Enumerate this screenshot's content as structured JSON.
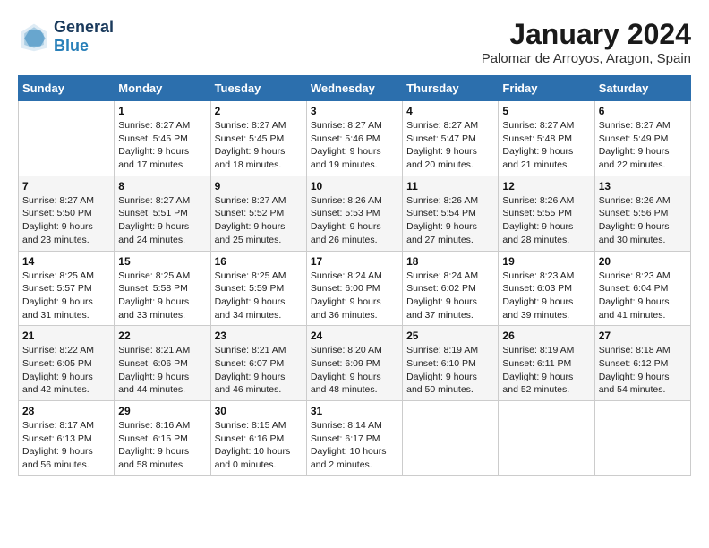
{
  "header": {
    "logo_line1": "General",
    "logo_line2": "Blue",
    "month_title": "January 2024",
    "location": "Palomar de Arroyos, Aragon, Spain"
  },
  "days_of_week": [
    "Sunday",
    "Monday",
    "Tuesday",
    "Wednesday",
    "Thursday",
    "Friday",
    "Saturday"
  ],
  "weeks": [
    [
      {
        "day": "",
        "sunrise": "",
        "sunset": "",
        "daylight": ""
      },
      {
        "day": "1",
        "sunrise": "Sunrise: 8:27 AM",
        "sunset": "Sunset: 5:45 PM",
        "daylight": "Daylight: 9 hours and 17 minutes."
      },
      {
        "day": "2",
        "sunrise": "Sunrise: 8:27 AM",
        "sunset": "Sunset: 5:45 PM",
        "daylight": "Daylight: 9 hours and 18 minutes."
      },
      {
        "day": "3",
        "sunrise": "Sunrise: 8:27 AM",
        "sunset": "Sunset: 5:46 PM",
        "daylight": "Daylight: 9 hours and 19 minutes."
      },
      {
        "day": "4",
        "sunrise": "Sunrise: 8:27 AM",
        "sunset": "Sunset: 5:47 PM",
        "daylight": "Daylight: 9 hours and 20 minutes."
      },
      {
        "day": "5",
        "sunrise": "Sunrise: 8:27 AM",
        "sunset": "Sunset: 5:48 PM",
        "daylight": "Daylight: 9 hours and 21 minutes."
      },
      {
        "day": "6",
        "sunrise": "Sunrise: 8:27 AM",
        "sunset": "Sunset: 5:49 PM",
        "daylight": "Daylight: 9 hours and 22 minutes."
      }
    ],
    [
      {
        "day": "7",
        "sunrise": "Sunrise: 8:27 AM",
        "sunset": "Sunset: 5:50 PM",
        "daylight": "Daylight: 9 hours and 23 minutes."
      },
      {
        "day": "8",
        "sunrise": "Sunrise: 8:27 AM",
        "sunset": "Sunset: 5:51 PM",
        "daylight": "Daylight: 9 hours and 24 minutes."
      },
      {
        "day": "9",
        "sunrise": "Sunrise: 8:27 AM",
        "sunset": "Sunset: 5:52 PM",
        "daylight": "Daylight: 9 hours and 25 minutes."
      },
      {
        "day": "10",
        "sunrise": "Sunrise: 8:26 AM",
        "sunset": "Sunset: 5:53 PM",
        "daylight": "Daylight: 9 hours and 26 minutes."
      },
      {
        "day": "11",
        "sunrise": "Sunrise: 8:26 AM",
        "sunset": "Sunset: 5:54 PM",
        "daylight": "Daylight: 9 hours and 27 minutes."
      },
      {
        "day": "12",
        "sunrise": "Sunrise: 8:26 AM",
        "sunset": "Sunset: 5:55 PM",
        "daylight": "Daylight: 9 hours and 28 minutes."
      },
      {
        "day": "13",
        "sunrise": "Sunrise: 8:26 AM",
        "sunset": "Sunset: 5:56 PM",
        "daylight": "Daylight: 9 hours and 30 minutes."
      }
    ],
    [
      {
        "day": "14",
        "sunrise": "Sunrise: 8:25 AM",
        "sunset": "Sunset: 5:57 PM",
        "daylight": "Daylight: 9 hours and 31 minutes."
      },
      {
        "day": "15",
        "sunrise": "Sunrise: 8:25 AM",
        "sunset": "Sunset: 5:58 PM",
        "daylight": "Daylight: 9 hours and 33 minutes."
      },
      {
        "day": "16",
        "sunrise": "Sunrise: 8:25 AM",
        "sunset": "Sunset: 5:59 PM",
        "daylight": "Daylight: 9 hours and 34 minutes."
      },
      {
        "day": "17",
        "sunrise": "Sunrise: 8:24 AM",
        "sunset": "Sunset: 6:00 PM",
        "daylight": "Daylight: 9 hours and 36 minutes."
      },
      {
        "day": "18",
        "sunrise": "Sunrise: 8:24 AM",
        "sunset": "Sunset: 6:02 PM",
        "daylight": "Daylight: 9 hours and 37 minutes."
      },
      {
        "day": "19",
        "sunrise": "Sunrise: 8:23 AM",
        "sunset": "Sunset: 6:03 PM",
        "daylight": "Daylight: 9 hours and 39 minutes."
      },
      {
        "day": "20",
        "sunrise": "Sunrise: 8:23 AM",
        "sunset": "Sunset: 6:04 PM",
        "daylight": "Daylight: 9 hours and 41 minutes."
      }
    ],
    [
      {
        "day": "21",
        "sunrise": "Sunrise: 8:22 AM",
        "sunset": "Sunset: 6:05 PM",
        "daylight": "Daylight: 9 hours and 42 minutes."
      },
      {
        "day": "22",
        "sunrise": "Sunrise: 8:21 AM",
        "sunset": "Sunset: 6:06 PM",
        "daylight": "Daylight: 9 hours and 44 minutes."
      },
      {
        "day": "23",
        "sunrise": "Sunrise: 8:21 AM",
        "sunset": "Sunset: 6:07 PM",
        "daylight": "Daylight: 9 hours and 46 minutes."
      },
      {
        "day": "24",
        "sunrise": "Sunrise: 8:20 AM",
        "sunset": "Sunset: 6:09 PM",
        "daylight": "Daylight: 9 hours and 48 minutes."
      },
      {
        "day": "25",
        "sunrise": "Sunrise: 8:19 AM",
        "sunset": "Sunset: 6:10 PM",
        "daylight": "Daylight: 9 hours and 50 minutes."
      },
      {
        "day": "26",
        "sunrise": "Sunrise: 8:19 AM",
        "sunset": "Sunset: 6:11 PM",
        "daylight": "Daylight: 9 hours and 52 minutes."
      },
      {
        "day": "27",
        "sunrise": "Sunrise: 8:18 AM",
        "sunset": "Sunset: 6:12 PM",
        "daylight": "Daylight: 9 hours and 54 minutes."
      }
    ],
    [
      {
        "day": "28",
        "sunrise": "Sunrise: 8:17 AM",
        "sunset": "Sunset: 6:13 PM",
        "daylight": "Daylight: 9 hours and 56 minutes."
      },
      {
        "day": "29",
        "sunrise": "Sunrise: 8:16 AM",
        "sunset": "Sunset: 6:15 PM",
        "daylight": "Daylight: 9 hours and 58 minutes."
      },
      {
        "day": "30",
        "sunrise": "Sunrise: 8:15 AM",
        "sunset": "Sunset: 6:16 PM",
        "daylight": "Daylight: 10 hours and 0 minutes."
      },
      {
        "day": "31",
        "sunrise": "Sunrise: 8:14 AM",
        "sunset": "Sunset: 6:17 PM",
        "daylight": "Daylight: 10 hours and 2 minutes."
      },
      {
        "day": "",
        "sunrise": "",
        "sunset": "",
        "daylight": ""
      },
      {
        "day": "",
        "sunrise": "",
        "sunset": "",
        "daylight": ""
      },
      {
        "day": "",
        "sunrise": "",
        "sunset": "",
        "daylight": ""
      }
    ]
  ]
}
